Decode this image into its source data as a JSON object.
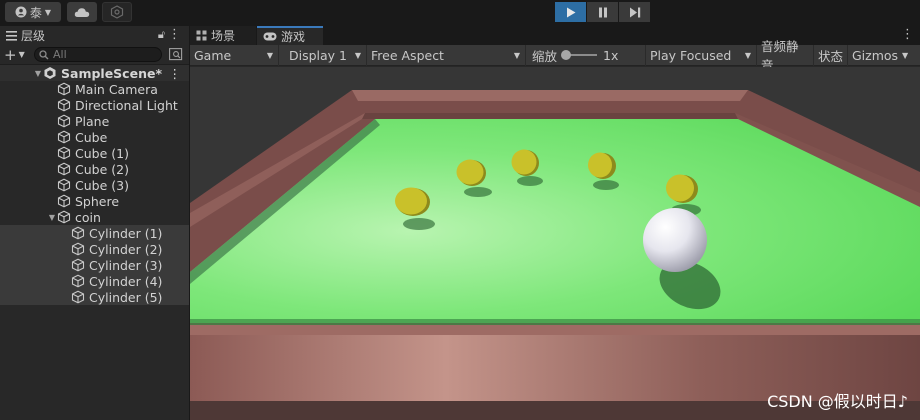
{
  "toolbar": {
    "account_label": "泰",
    "play_icon": "play-icon",
    "pause_icon": "pause-icon",
    "step_icon": "step-icon"
  },
  "hierarchy": {
    "tab_label": "层级",
    "search_placeholder": "All",
    "scene_name": "SampleScene*",
    "items": [
      {
        "label": "Main Camera"
      },
      {
        "label": "Directional Light"
      },
      {
        "label": "Plane"
      },
      {
        "label": "Cube"
      },
      {
        "label": "Cube (1)"
      },
      {
        "label": "Cube (2)"
      },
      {
        "label": "Cube (3)"
      },
      {
        "label": "Sphere"
      }
    ],
    "coin": {
      "label": "coin",
      "children": [
        {
          "label": "Cylinder (1)"
        },
        {
          "label": "Cylinder (2)"
        },
        {
          "label": "Cylinder (3)"
        },
        {
          "label": "Cylinder (4)"
        },
        {
          "label": "Cylinder (5)"
        }
      ]
    }
  },
  "game": {
    "tabs": [
      {
        "label": "场景"
      },
      {
        "label": "游戏"
      }
    ],
    "toolbar": {
      "mode": "Game",
      "display": "Display 1",
      "aspect": "Free Aspect",
      "scale_label": "缩放",
      "scale_value": "1x",
      "play_mode": "Play Focused",
      "mute": "音频静音",
      "stats": "状态",
      "gizmos": "Gizmos"
    },
    "colors": {
      "floor": "#6ee86e",
      "wall": "#8a5a55",
      "coin": "#c9c12a",
      "ball": "#e8e8ee"
    }
  },
  "watermark": "CSDN @假以时日♪"
}
